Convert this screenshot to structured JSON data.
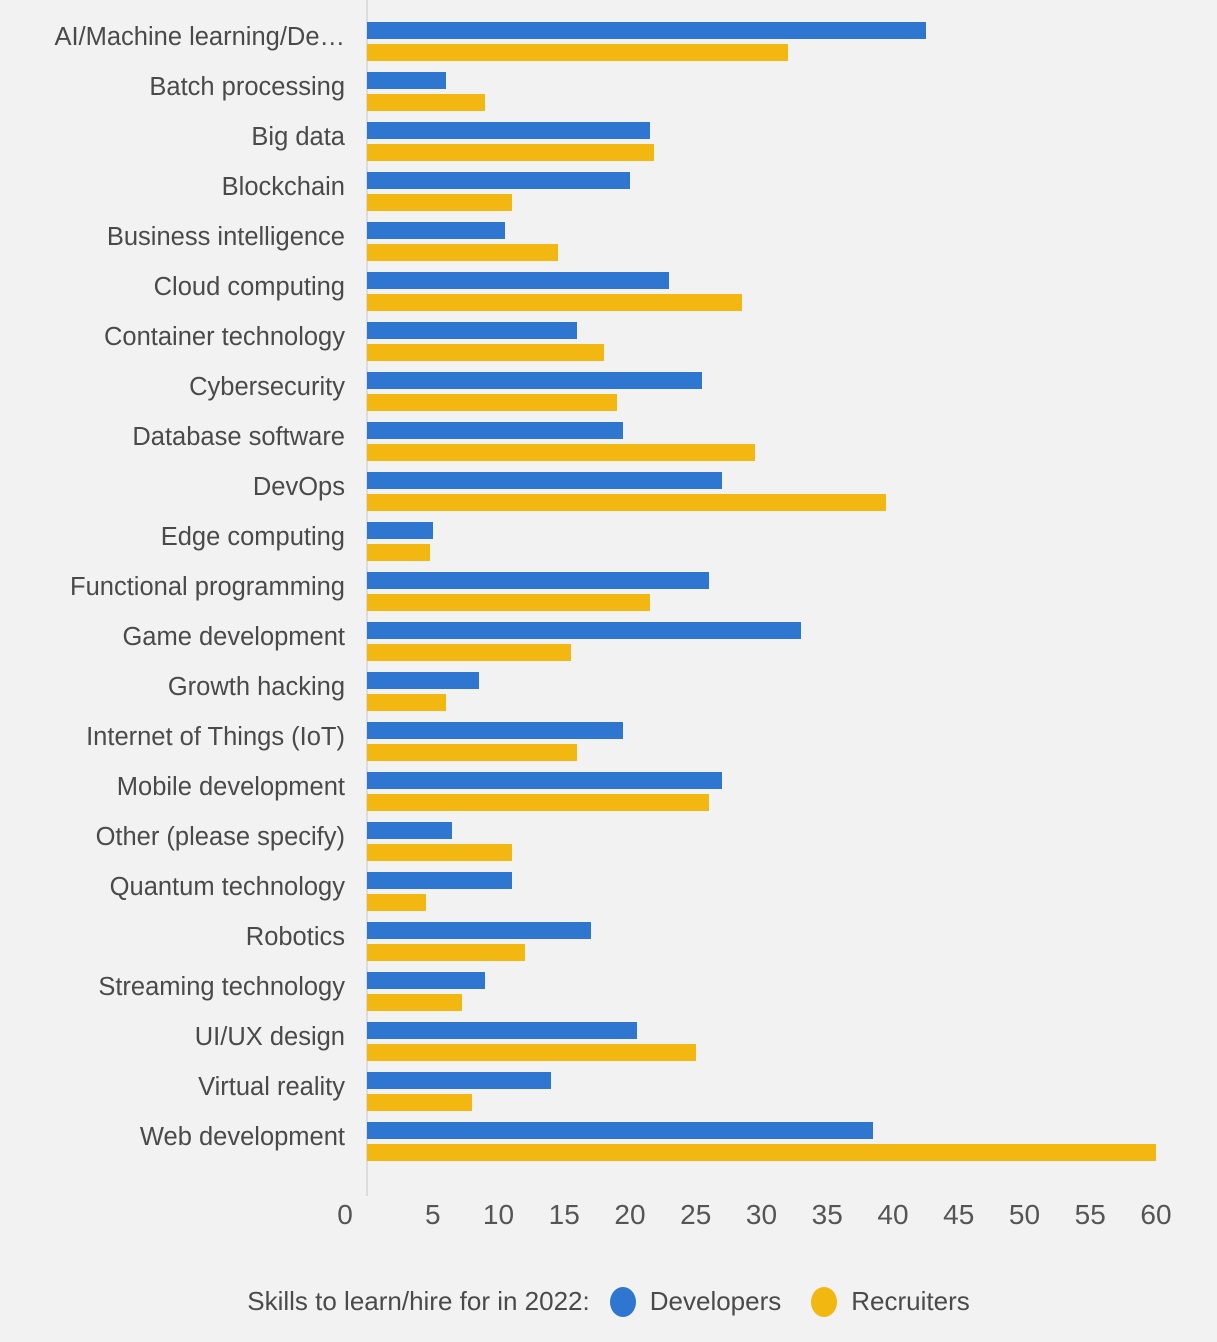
{
  "chart_data": {
    "type": "bar",
    "orientation": "horizontal",
    "title": "",
    "xlabel": "",
    "ylabel": "",
    "xlim": [
      0,
      60
    ],
    "grid": false,
    "legend_position": "bottom",
    "legend_title": "Skills to learn/hire for in 2022:",
    "x_ticks": [
      0,
      5,
      10,
      15,
      20,
      25,
      30,
      35,
      40,
      45,
      50,
      55,
      60
    ],
    "categories": [
      "AI/Machine learning/De…",
      "Batch processing",
      "Big data",
      "Blockchain",
      "Business intelligence",
      "Cloud computing",
      "Container technology",
      "Cybersecurity",
      "Database software",
      "DevOps",
      "Edge computing",
      "Functional programming",
      "Game development",
      "Growth hacking",
      "Internet of Things (IoT)",
      "Mobile development",
      "Other (please specify)",
      "Quantum technology",
      "Robotics",
      "Streaming technology",
      "UI/UX design",
      "Virtual reality",
      "Web development"
    ],
    "series": [
      {
        "name": "Developers",
        "color": "#2f76d0",
        "values": [
          42.5,
          6,
          21.5,
          20,
          10.5,
          23,
          16,
          25.5,
          19.5,
          27,
          5,
          26,
          33,
          8.5,
          19.5,
          27,
          6.5,
          11,
          17,
          9,
          20.5,
          14,
          38.5
        ]
      },
      {
        "name": "Recruiters",
        "color": "#f2b711",
        "values": [
          32,
          9,
          21.8,
          11,
          14.5,
          28.5,
          18,
          19,
          29.5,
          39.5,
          4.8,
          21.5,
          15.5,
          6,
          16,
          26,
          11,
          4.5,
          12,
          7.2,
          25,
          8,
          60
        ]
      }
    ]
  },
  "colors": {
    "background": "#f2f2f2",
    "developers": "#2f76d0",
    "recruiters": "#f2b711",
    "axis": "#dcdcdc",
    "text": "#4a4a4a"
  }
}
